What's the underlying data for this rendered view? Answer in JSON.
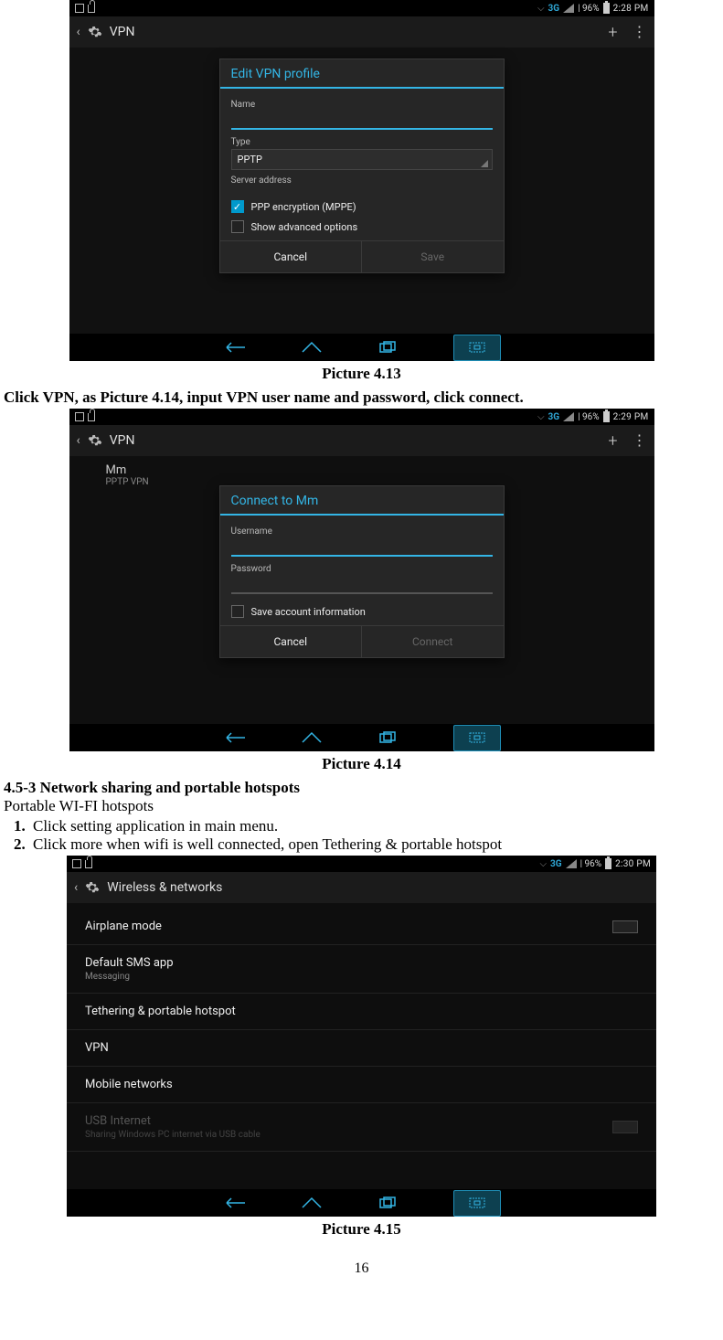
{
  "captions": {
    "p413": "Picture 4.13",
    "p414": "Picture 4.14",
    "p415": "Picture 4.15"
  },
  "text": {
    "instr1": "Click VPN, as Picture 4.14, input VPN user name and password, click connect.",
    "section_head": "4.5-3 Network sharing and portable hotspots",
    "line2": "Portable WI-FI hotspots",
    "step1": "Click setting application in main menu.",
    "step2": "Click more when wifi is well connected, open Tethering & portable hotspot",
    "page_number": "16"
  },
  "shot1": {
    "status": {
      "right_3g": "3G",
      "battery_pct": "| 96%",
      "time": "2:28 PM"
    },
    "actionbar": {
      "title": "VPN"
    },
    "dialog": {
      "title": "Edit VPN profile",
      "name_label": "Name",
      "type_label": "Type",
      "type_value": "PPTP",
      "server_label": "Server address",
      "chk_ppp": "PPP encryption (MPPE)",
      "chk_adv": "Show advanced options",
      "btn_cancel": "Cancel",
      "btn_save": "Save"
    }
  },
  "shot2": {
    "status": {
      "right_3g": "3G",
      "battery_pct": "| 96%",
      "time": "2:29 PM"
    },
    "actionbar": {
      "title": "VPN"
    },
    "vpn_entry": {
      "name": "Mm",
      "sub": "PPTP VPN"
    },
    "dialog": {
      "title": "Connect to Mm",
      "user_label": "Username",
      "pass_label": "Password",
      "chk_save": "Save account information",
      "btn_cancel": "Cancel",
      "btn_connect": "Connect"
    }
  },
  "shot3": {
    "status": {
      "right_3g": "3G",
      "battery_pct": "| 96%",
      "time": "2:30 PM"
    },
    "actionbar": {
      "title": "Wireless & networks"
    },
    "items": [
      {
        "title": "Airplane mode"
      },
      {
        "title": "Default SMS app",
        "sub": "Messaging"
      },
      {
        "title": "Tethering & portable hotspot"
      },
      {
        "title": "VPN"
      },
      {
        "title": "Mobile networks"
      },
      {
        "title": "USB Internet",
        "sub": "Sharing Windows PC internet via USB cable"
      }
    ]
  }
}
